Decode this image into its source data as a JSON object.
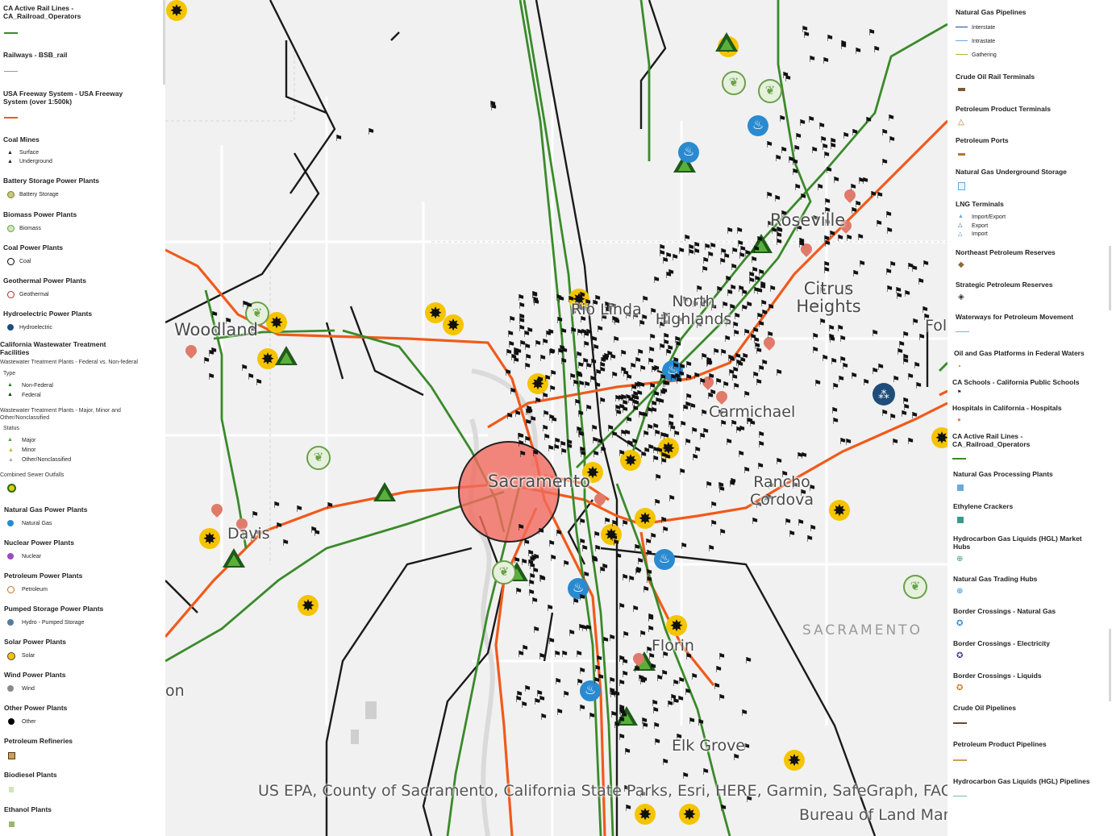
{
  "map": {
    "places": [
      {
        "name": "Woodland",
        "key": "woodland"
      },
      {
        "name": "Rio Linda",
        "key": "rio-linda"
      },
      {
        "name": "North Highlands",
        "key": "north-highlands"
      },
      {
        "name": "Roseville",
        "key": "roseville"
      },
      {
        "name": "Citrus Heights",
        "key": "citrus-heights"
      },
      {
        "name": "Carmichael",
        "key": "carmichael"
      },
      {
        "name": "Sacramento",
        "key": "sacramento"
      },
      {
        "name": "Rancho Cordova",
        "key": "rancho-cordova"
      },
      {
        "name": "Davis",
        "key": "davis"
      },
      {
        "name": "Florin",
        "key": "florin"
      },
      {
        "name": "Elk Grove",
        "key": "elk-grove"
      },
      {
        "name": "Fol",
        "key": "folsom-partial"
      },
      {
        "name": "on",
        "key": "partial-left"
      }
    ],
    "region_label": "SACRAMENTO",
    "attribution_line1": "US EPA, County of Sacramento, California State Parks, Esri, HERE, Garmin, SafeGraph, FAO",
    "attribution_line2": "Bureau of Land Management, EPA, NPS",
    "colors": {
      "rail": "#3a8a2a",
      "freeway": "#f05a1a",
      "pipeline": "#1a1a1a",
      "highlight": "#f26a5e",
      "solar": "#f5c400"
    }
  },
  "legend_left": {
    "rail_title": "CA Active Rail Lines - CA_Railroad_Operators",
    "railways_title": "Railways - BSB_rail",
    "freeway_title": "USA Freeway System - USA Freeway System (over 1:500k)",
    "coal_mines": {
      "title": "Coal Mines",
      "items": [
        "Surface",
        "Underground"
      ]
    },
    "battery": {
      "title": "Battery Storage Power Plants",
      "item": "Battery Storage"
    },
    "biomass": {
      "title": "Biomass Power Plants",
      "item": "Biomass"
    },
    "coal_power": {
      "title": "Coal Power Plants",
      "item": "Coal"
    },
    "geothermal": {
      "title": "Geothermal Power Plants",
      "item": "Geothermal"
    },
    "hydro": {
      "title": "Hydroelectric Power Plants",
      "item": "Hydroelectric"
    },
    "wastewater": {
      "title": "California Wastewater Treatment Facilities",
      "sub1": "Wastewater Treatment Plants - Federal vs. Non-federal",
      "type_label": "Type",
      "type_items": [
        "Non-Federal",
        "Federal"
      ],
      "sub2": "Wastewater Treatment Plants - Major, Minor and Other/Nonclassified",
      "status_label": "Status",
      "status_items": [
        "Major",
        "Minor",
        "Other/Nonclassified"
      ],
      "sewer": "Combined Sewer Outfalls"
    },
    "natural_gas": {
      "title": "Natural Gas Power Plants",
      "item": "Natural Gas"
    },
    "nuclear": {
      "title": "Nuclear Power Plants",
      "item": "Nuclear"
    },
    "petroleum_power": {
      "title": "Petroleum Power Plants",
      "item": "Petroleum"
    },
    "pumped": {
      "title": "Pumped Storage Power Plants",
      "item": "Hydro - Pumped Storage"
    },
    "solar": {
      "title": "Solar Power Plants",
      "item": "Solar"
    },
    "wind": {
      "title": "Wind Power Plants",
      "item": "Wind"
    },
    "other": {
      "title": "Other Power Plants",
      "item": "Other"
    },
    "refineries": "Petroleum Refineries",
    "biodiesel": "Biodiesel Plants",
    "ethanol": "Ethanol Plants"
  },
  "legend_right": {
    "ng_pipelines": {
      "title": "Natural Gas Pipelines",
      "items": [
        "Interstate",
        "Intrastate",
        "Gathering"
      ]
    },
    "crude_rail": "Crude Oil Rail Terminals",
    "petro_terminals": "Petroleum Product Terminals",
    "petro_ports": "Petroleum Ports",
    "ng_storage": "Natural Gas Underground Storage",
    "lng": {
      "title": "LNG Terminals",
      "items": [
        "Import/Export",
        "Export",
        "Import"
      ]
    },
    "ne_reserves": "Northeast Petroleum Reserves",
    "strategic_reserves": "Strategic Petroleum Reserves",
    "waterways": "Waterways for Petroleum Movement",
    "platforms": "Oil and Gas Platforms in Federal Waters",
    "schools": "CA Schools - California Public Schools",
    "hospitals": "Hospitals in California - Hospitals",
    "rail2": "CA Active Rail Lines - CA_Railroad_Operators",
    "ng_processing": "Natural Gas Processing Plants",
    "ethylene": "Ethylene Crackers",
    "hgl_hubs": "Hydrocarbon Gas Liquids (HGL) Market Hubs",
    "ng_trading": "Natural Gas Trading Hubs",
    "border_ng": "Border Crossings - Natural Gas",
    "border_elec": "Border Crossings - Electricity",
    "border_liquids": "Border Crossings - Liquids",
    "crude_pipelines": "Crude Oil Pipelines",
    "petro_pipelines": "Petroleum Product Pipelines",
    "hgl_pipelines": "Hydrocarbon Gas Liquids (HGL) Pipelines"
  }
}
